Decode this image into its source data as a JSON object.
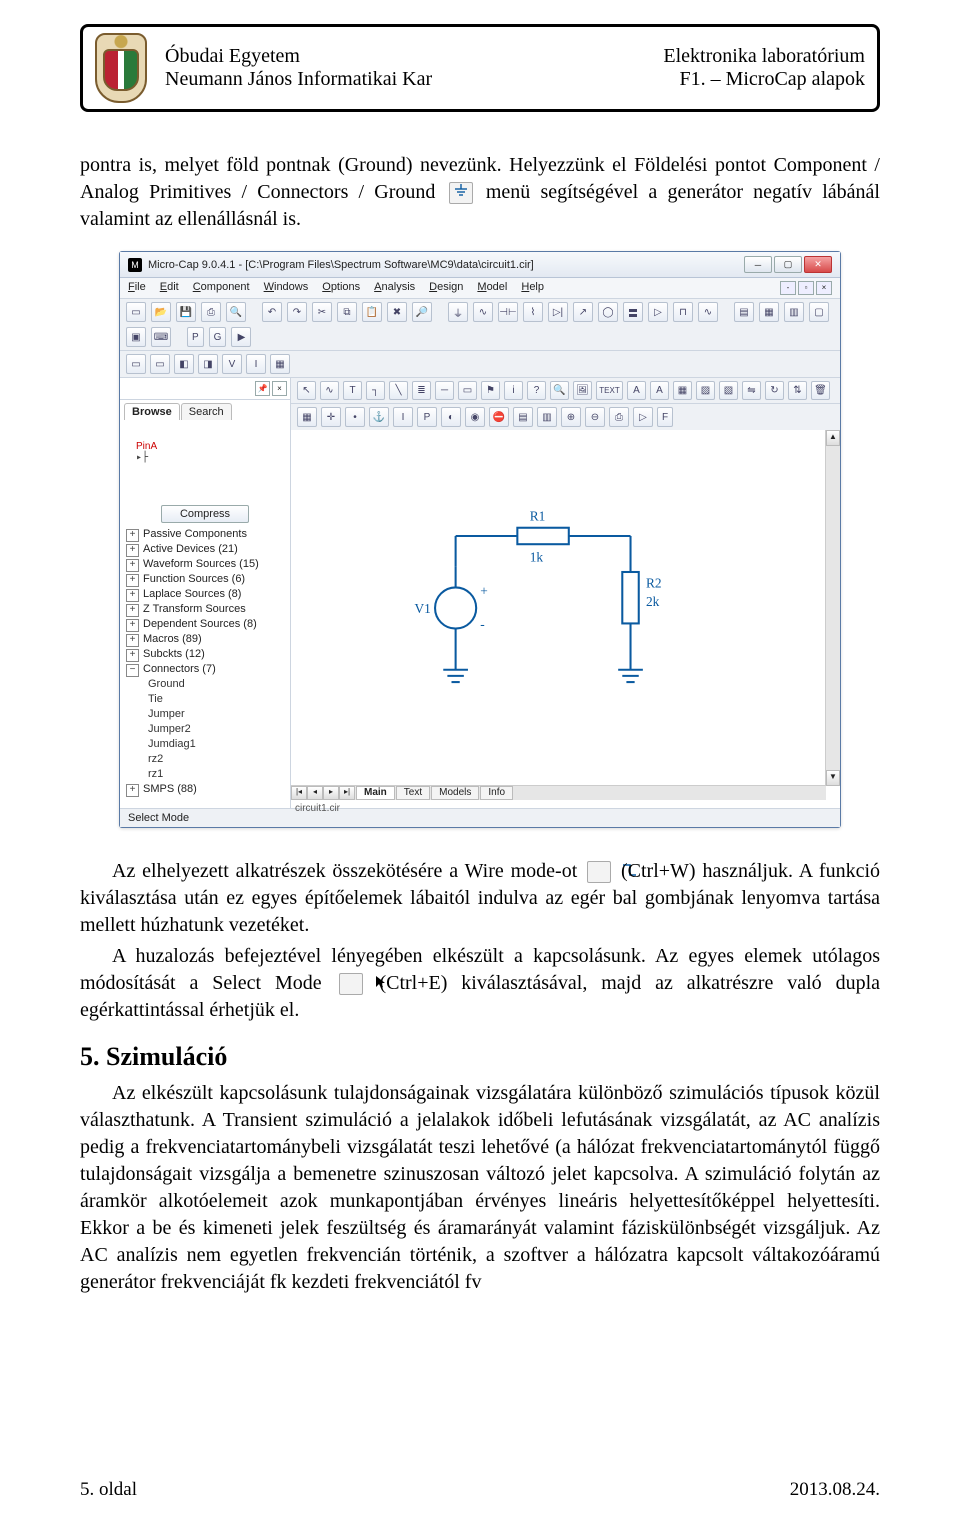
{
  "header": {
    "uni": "Óbudai Egyetem",
    "faculty": "Neumann János Informatikai Kar",
    "lab": "Elektronika laboratórium",
    "topic": "F1. – MicroCap alapok"
  },
  "para1a": "pontra is, melyet föld pontnak (Ground) nevezünk. Helyezzünk el Földelési pontot Component / Analog Primitives / Connectors / Ground ",
  "para1b": " menü segítségével a generátor negatív lábánál valamint az ellenállásnál is.",
  "screenshot": {
    "title": "Micro-Cap 9.0.4.1 - [C:\\Program Files\\Spectrum Software\\MC9\\data\\circuit1.cir]",
    "menus": [
      "File",
      "Edit",
      "Component",
      "Windows",
      "Options",
      "Analysis",
      "Design",
      "Model",
      "Help"
    ],
    "sideTabs": {
      "browse": "Browse",
      "search": "Search"
    },
    "pin": "PinA",
    "compress": "Compress",
    "tree": [
      {
        "pm": "+",
        "label": "Passive Components"
      },
      {
        "pm": "+",
        "label": "Active Devices (21)"
      },
      {
        "pm": "+",
        "label": "Waveform Sources (15)"
      },
      {
        "pm": "+",
        "label": "Function Sources (6)"
      },
      {
        "pm": "+",
        "label": "Laplace Sources (8)"
      },
      {
        "pm": "+",
        "label": "Z Transform Sources"
      },
      {
        "pm": "+",
        "label": "Dependent Sources (8)"
      },
      {
        "pm": "+",
        "label": "Macros (89)"
      },
      {
        "pm": "+",
        "label": "Subckts (12)"
      },
      {
        "pm": "−",
        "label": "Connectors (7)"
      }
    ],
    "leaves": [
      "Ground",
      "Tie",
      "Jumper",
      "Jumper2",
      "Jumdiag1",
      "rz2",
      "rz1"
    ],
    "treeLast": {
      "pm": "+",
      "label": "SMPS (88)"
    },
    "bottomTabs": [
      "Main",
      "Text",
      "Models",
      "Info"
    ],
    "filename": "circuit1.cir",
    "status": "Select Mode",
    "circuit": {
      "v1": "V1",
      "r1": "R1",
      "r1v": "1k",
      "r2": "R2",
      "r2v": "2k"
    }
  },
  "para2a": "Az elhelyezett alkatrészek összekötésére a Wire mode-ot ",
  "para2b": " (Ctrl+W) használjuk. A funkció kiválasztása után ez egyes építőelemek lábaitól indulva az egér bal gombjának lenyomva tartása mellett húzhatunk vezetéket.",
  "para3a": "A huzalozás befejeztével lényegében elkészült a kapcsolásunk. Az egyes elemek utólagos módosítását a Select Mode ",
  "para3b": " (Ctrl+E) kiválasztásával, majd az alkatrészre való dupla egérkattintással érhetjük el.",
  "h2": "5. Szimuláció",
  "para4": "Az elkészült kapcsolásunk tulajdonságainak vizsgálatára különböző szimulációs típusok közül választhatunk. A Transient szimuláció a jelalakok időbeli lefutásának vizsgálatát, az AC analízis pedig a frekvenciatartománybeli vizsgálatát teszi lehetővé (a hálózat frekvenciatartománytól függő tulajdonságait vizsgálja a bemenetre szinuszosan változó jelet kapcsolva. A szimuláció folytán az áramkör alkotóelemeit azok munkapontjában érvényes lineáris helyettesítőképpel helyettesíti. Ekkor a be és kimeneti jelek feszültség és áramarányát valamint fáziskülönbségét vizsgáljuk. Az AC analízis nem egyetlen frekvencián történik, a szoftver a hálózatra kapcsolt váltakozóáramú generátor frekvenciáját fk kezdeti frekvenciától fv",
  "footer": {
    "page": "5. oldal",
    "date": "2013.08.24."
  }
}
